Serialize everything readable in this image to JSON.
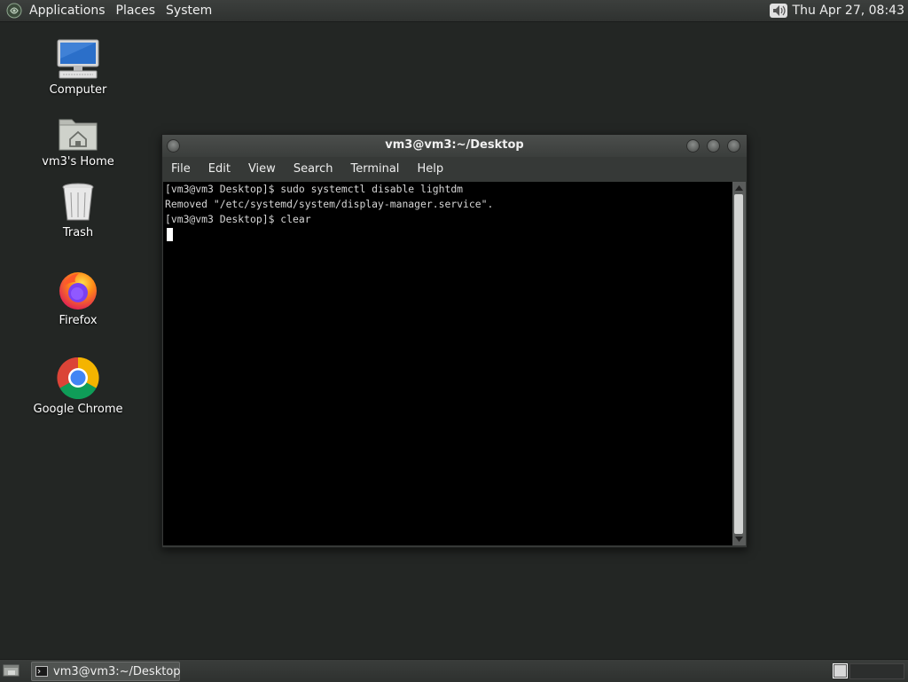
{
  "top_panel": {
    "menus": [
      "Applications",
      "Places",
      "System"
    ],
    "clock": "Thu Apr 27, 08:43",
    "icons": {
      "logo": "gnome-foot-icon",
      "volume": "speaker-icon"
    }
  },
  "desktop_icons": [
    {
      "label": "Computer",
      "icon": "computer-icon"
    },
    {
      "label": "vm3's Home",
      "icon": "home-folder-icon"
    },
    {
      "label": "Trash",
      "icon": "trash-icon"
    },
    {
      "label": "Firefox",
      "icon": "firefox-icon"
    },
    {
      "label": "Google Chrome",
      "icon": "chrome-icon"
    }
  ],
  "terminal_window": {
    "title": "vm3@vm3:~/Desktop",
    "menus": [
      "File",
      "Edit",
      "View",
      "Search",
      "Terminal",
      "Help"
    ],
    "lines": [
      "[vm3@vm3 Desktop]$ sudo systemctl disable lightdm",
      "Removed \"/etc/systemd/system/display-manager.service\".",
      "[vm3@vm3 Desktop]$ clear"
    ]
  },
  "taskbar": {
    "task_label": "vm3@vm3:~/Desktop"
  },
  "colors": {
    "desktop_bg": "#232624",
    "panel_bg": "#333634",
    "terminal_bg": "#000000",
    "terminal_fg": "#d6d6d6"
  }
}
